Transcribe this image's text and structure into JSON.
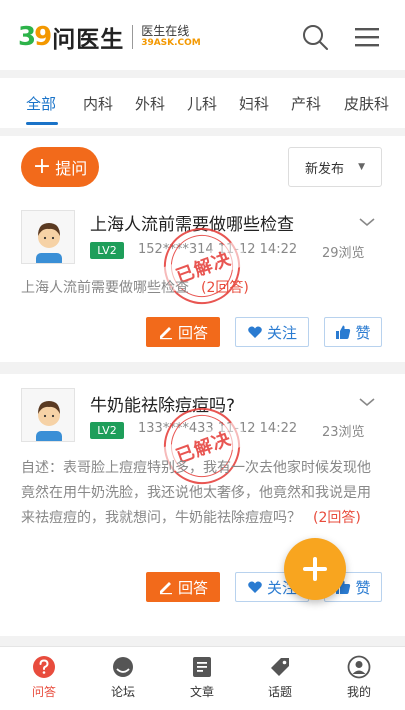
{
  "header": {
    "logo_number_a": "3",
    "logo_number_b": "9",
    "logo_name": "问医生",
    "logo_sub_cn": "医生在线",
    "logo_sub_en": "39ASK.COM"
  },
  "tabs": [
    {
      "label": "全部",
      "active": true
    },
    {
      "label": "内科"
    },
    {
      "label": "外科"
    },
    {
      "label": "儿科"
    },
    {
      "label": "妇科"
    },
    {
      "label": "产科"
    },
    {
      "label": "皮肤科"
    }
  ],
  "toolbar": {
    "ask_label": "提问",
    "ask_plus": "+",
    "sort_value": "新发布",
    "sort_caret": "▼"
  },
  "questions": [
    {
      "title": "上海人流前需要做哪些检查",
      "level": "LV2",
      "meta": "152****314 11-12 14:22",
      "views": "29浏览",
      "stamp": "已解决",
      "summary": "上海人流前需要做哪些检查",
      "answers": "(2回答)",
      "answer_label": "回答",
      "follow_label": "关注",
      "like_label": "赞"
    },
    {
      "title": "牛奶能祛除痘痘吗?",
      "level": "LV2",
      "meta": "133****433 11-12 14:22",
      "views": "23浏览",
      "stamp": "已解决",
      "summary": "自述：表哥脸上痘痘特别多，我有一次去他家时候发现他竟然在用牛奶洗脸，我还说他太奢侈，他竟然和我说是用来祛痘痘的，我就想问，牛奶能祛除痘痘吗？",
      "answers": "(2回答)",
      "answer_label": "回答",
      "follow_label": "关注",
      "like_label": "赞"
    }
  ],
  "bottom_nav": [
    {
      "label": "问答",
      "icon": "question-icon",
      "active": true
    },
    {
      "label": "论坛",
      "icon": "forum-icon"
    },
    {
      "label": "文章",
      "icon": "article-icon"
    },
    {
      "label": "话题",
      "icon": "topic-tag-icon"
    },
    {
      "label": "我的",
      "icon": "profile-icon"
    }
  ],
  "colors": {
    "accent_orange": "#f26a1b",
    "tab_active_blue": "#1a73c8",
    "level_green": "#1e9e5a",
    "stamp_red": "#e53935",
    "fab_orange": "#f8a51f"
  }
}
